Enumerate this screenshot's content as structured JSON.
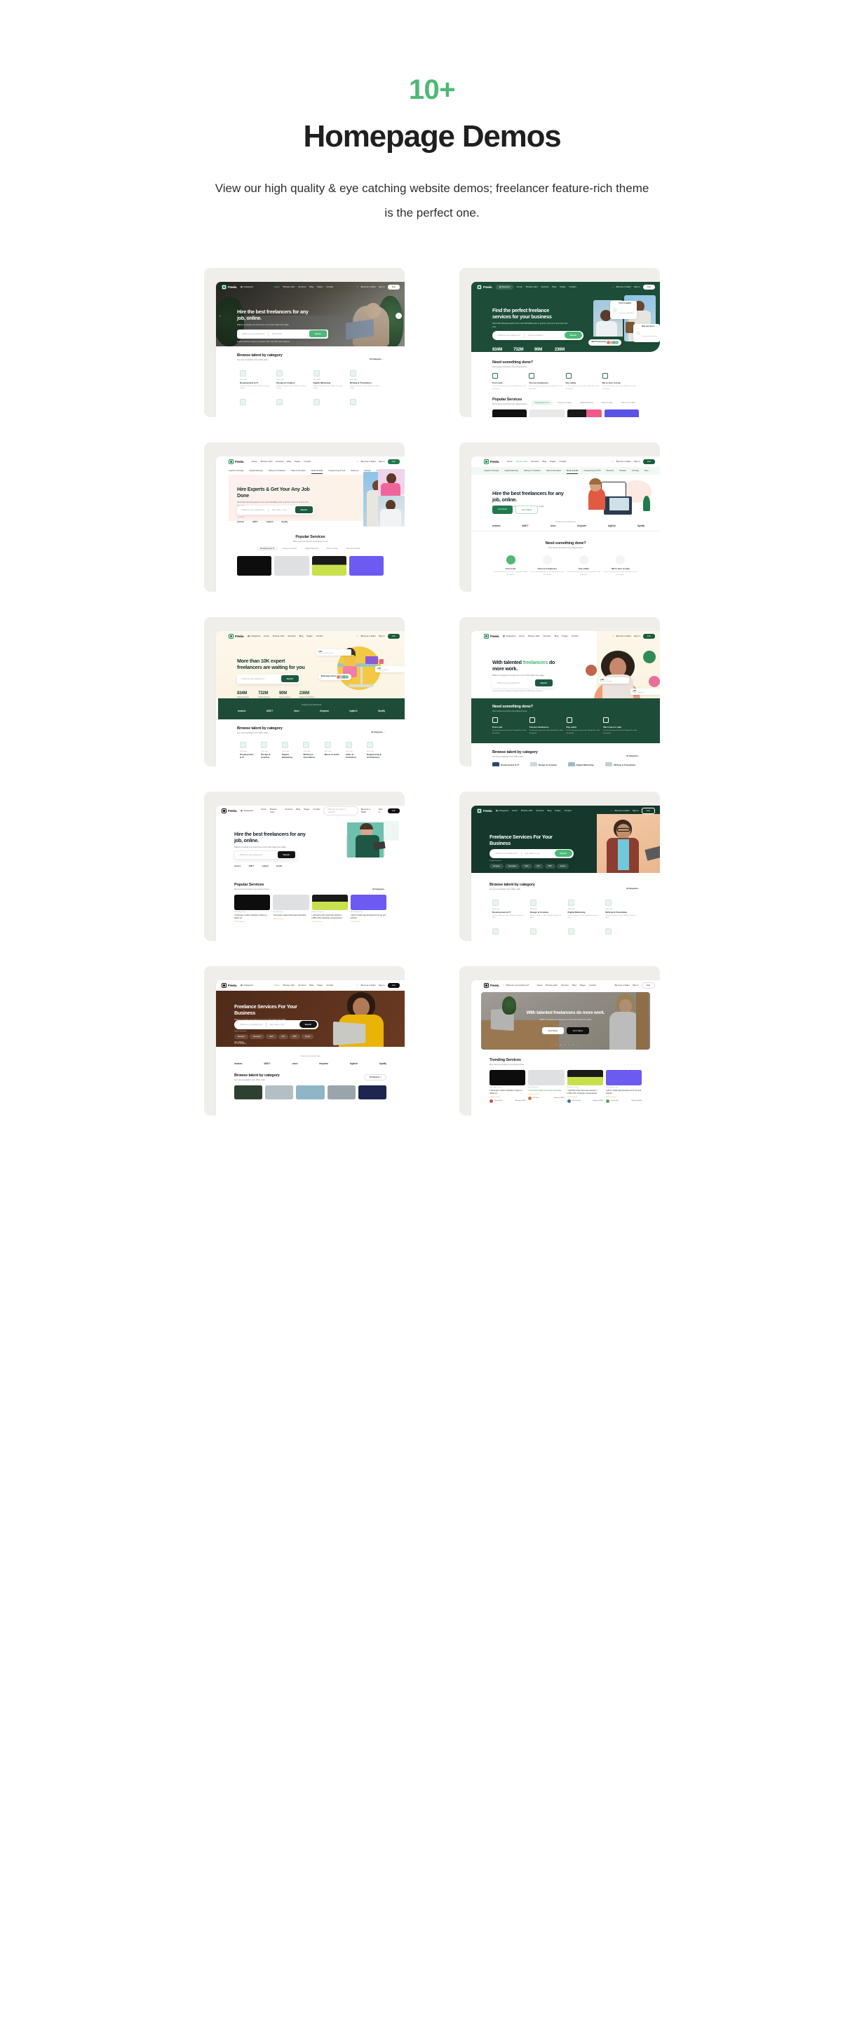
{
  "section": {
    "eyebrow": "10+",
    "title": "Homepage Demos",
    "subtitle": "View our high quality & eye catching website demos; freelancer feature-rich theme is the perfect one.",
    "accent_color": "#4eb877",
    "card_bg": "#f0eeea",
    "page_bg": "#ffffff"
  },
  "brand": {
    "name": "Freeio.",
    "categories_label": "Categories",
    "nav": [
      "Home",
      "Browse Jobs",
      "Services",
      "Blog",
      "Pages",
      "Contact"
    ],
    "become_seller": "Become a Seller",
    "sign_in": "Sign in",
    "join": "Join",
    "search_placeholder": "What do you want to search?"
  },
  "common": {
    "search_placeholder": "What are you looking for?",
    "select_role": "Select Role",
    "choose_category": "Choose Category",
    "city_state_zip": "City, state, or zip",
    "search_button": "Search",
    "popular_searches_label": "Popular Searches",
    "popular_searches": "Designer, Developer, Web, iOS, PHP, Senior, Engineer",
    "trusted_by": "Trusted by the world's best",
    "trusted_by_short": "Trusted by",
    "all_categories": "All Categories",
    "all_category": "All Category",
    "browse_talent_title": "Browse talent by category",
    "browse_talent_sub": "Get some Inspirations from 1800+ skills",
    "need_something_title": "Need something done?",
    "need_something_sub": "Most viewed and all-time top-selling services",
    "popular_services_title": "Popular Services",
    "trending_services_title": "Trending Services",
    "find_work": "Find Work",
    "find_talent": "Find Talent",
    "brands": [
      "amazon",
      "AMD⇡",
      "cisco",
      "dropcam",
      "logitech",
      "Spotify"
    ],
    "brands_short": [
      "amazon",
      "AMD⇡",
      "logitech",
      "Spotify"
    ],
    "stats": [
      {
        "n": "834M",
        "l": "Total Freelancer"
      },
      {
        "n": "732M",
        "l": "Positive Review"
      },
      {
        "n": "90M",
        "l": "Order received"
      },
      {
        "n": "236M",
        "l": "Projects Completed"
      }
    ],
    "features": [
      {
        "name": "Post a job",
        "desc": "It's free and easy to post a job. Simply fill in a title, description."
      },
      {
        "name": "Choose freelancers",
        "desc": "It's free and easy to post a job. Simply fill in a title, description."
      },
      {
        "name": "Pay safely",
        "desc": "It's free and easy to post a job. Simply fill in a title, description."
      },
      {
        "name": "We're here to help",
        "desc": "It's free and easy to post a job. Simply fill in a title, description."
      }
    ],
    "categories": [
      {
        "k": "1853 skills",
        "n": "Development & IT",
        "d": "Software Engineer, Web / Mobile Developer & More"
      },
      {
        "k": "1853 skills",
        "n": "Design & Creative",
        "d": "Software Engineer, Web / Mobile Developer & More"
      },
      {
        "k": "1853 skills",
        "n": "Digital Marketing",
        "d": "Software Engineer, Web / Mobile Developer & More"
      },
      {
        "k": "1853 skills",
        "n": "Writing & Translation",
        "d": "Software Engineer, Web / Mobile Developer & More"
      },
      {
        "k": "1853 skills",
        "n": "Music & Audio",
        "d": "Software Engineer, Web / Mobile Developer & More"
      },
      {
        "k": "1853 skills",
        "n": "Video & Animation",
        "d": "Software Engineer, Web / Mobile Developer & More"
      },
      {
        "k": "1853 skills",
        "n": "Engineering & Architecture",
        "d": "Software Engineer, Web / Mobile Developer & More"
      }
    ],
    "service_tabs": [
      "Development & IT",
      "Design & Creative",
      "Digital Marketing",
      "Music & Audio",
      "Video & Animation"
    ],
    "subnav": [
      "Graphics & Design",
      "Digital Marketing",
      "Writing & Translation",
      "Video & Animation",
      "Music & Audio",
      "Programming & Tech",
      "Business",
      "Lifestyle",
      "Trending",
      "More"
    ],
    "search_chips": [
      "Designer",
      "Developer",
      "Web",
      "iOS",
      "PHP",
      "Senior"
    ],
    "services": [
      {
        "k": "Web & App Design",
        "t": "I will design modern websites in figma or adobe xd",
        "r": "4.82 94 reviews",
        "seller": "Wanda Rune",
        "price": "Starting at $983"
      },
      {
        "k": "Art & Illustration",
        "t": "I will create modern flat design illustration",
        "r": "4.82 94 reviews",
        "seller": "Ali Tufan",
        "price": "Starting at $983"
      },
      {
        "k": "Design & Creative",
        "t": "I will build a fully responsive design in HTML,CSS, bootstrap, and javascript",
        "r": "4.82 94 reviews",
        "seller": "Eleanor Pena",
        "price": "Starting at $983"
      },
      {
        "k": "Web & App Design",
        "t": "I will do mobile app development for ios and android",
        "r": "4.82 94 reviews",
        "seller": "Jerome Bell",
        "price": "Starting at $983"
      }
    ],
    "badges": {
      "proof_of_quality": "Proof of quality",
      "proof_of_quality_sub": "Lorem ipsum dolor Amet",
      "safe_and_secure": "Safe and secure",
      "safe_and_secure_sub": "Lorem Ipsum Dolor Amet",
      "professionals": "681k Professionals",
      "happy_clients": "684k Happy Clients",
      "rating": "4.9/5",
      "rating_sub": "Clients rate professionals",
      "projects": "+2M",
      "projects_sub": "Project Completed",
      "talent_rating": "4.9/5",
      "talent_rating_sub": "Ali Tufan / Designer"
    },
    "person": {
      "name": "Jerry Wilson",
      "role": "UI / UX Designer"
    }
  },
  "demos": [
    {
      "id": "demo-1",
      "style": "photo-dark",
      "headline": "Hire the best freelancers for any job, online.",
      "sub": "Millions of people use freeio.com to turn their ideas into reality.",
      "nav_active": "Home",
      "search_style": "split-role",
      "section_title": "Browse talent by category"
    },
    {
      "id": "demo-2",
      "style": "green-hero",
      "headline": "Find the perfect freelance services for your business",
      "sub": "Work with talented people at the most affordable price to get the most out of your time and cost",
      "search_style": "split-category",
      "section_title": "Need something done?",
      "second_section_title": "Popular Services"
    },
    {
      "id": "demo-3",
      "style": "pink-hero",
      "headline": "Hire Experts & Get Your Any Job Done",
      "sub": "Work with talented people at the most affordable price to get the most out of your time and cost",
      "search_style": "split-city",
      "section_title": "Popular Services"
    },
    {
      "id": "demo-4",
      "style": "illustration-light",
      "headline": "Hire the best freelancers for any job, online.",
      "sub": "Millions of people use freeio.com to turn their ideas into reality.",
      "nav_active": "Browse Jobs",
      "search_style": "buttons",
      "section_title": "Need something done?"
    },
    {
      "id": "demo-5",
      "style": "cream-3d",
      "headline": "More than 10K expert freelancers are waiting for you",
      "search_style": "simple",
      "section_title": "Browse talent by category"
    },
    {
      "id": "demo-6",
      "style": "talented-light",
      "headline": "With talented freelancers do more work.",
      "headline_accent": "freelancers",
      "sub": "Millions of people use freeio.com to turn their ideas into reality.",
      "search_style": "simple",
      "section_title": "Need something done?",
      "second_section_title": "Browse talent by category"
    },
    {
      "id": "demo-7",
      "style": "mint-photo",
      "headline": "Hire the best freelancers for any job, online.",
      "sub": "Millions of people use freeio.com to turn their ideas into reality.",
      "search_style": "simple-black",
      "section_title": "Popular Services"
    },
    {
      "id": "demo-8",
      "style": "dark-green-photo",
      "headline": "Freelance Services For Your Business",
      "search_style": "split-city-pill",
      "section_title": "Browse talent by category"
    },
    {
      "id": "demo-9",
      "style": "brown-photo",
      "headline": "Freelance Services For Your Business",
      "sub": "Millions of people use freeio.com to turn their ideas into reality.",
      "nav_active": "Home",
      "search_style": "split-city-pill-black",
      "section_title": "Browse talent by category"
    },
    {
      "id": "demo-10",
      "style": "banner-photo",
      "headline": "With talented freelancers do more work.",
      "sub": "Millions of people use freeio.com to turn their ideas into reality.",
      "search_style": "buttons-overlay",
      "section_title": "Trending Services"
    }
  ]
}
